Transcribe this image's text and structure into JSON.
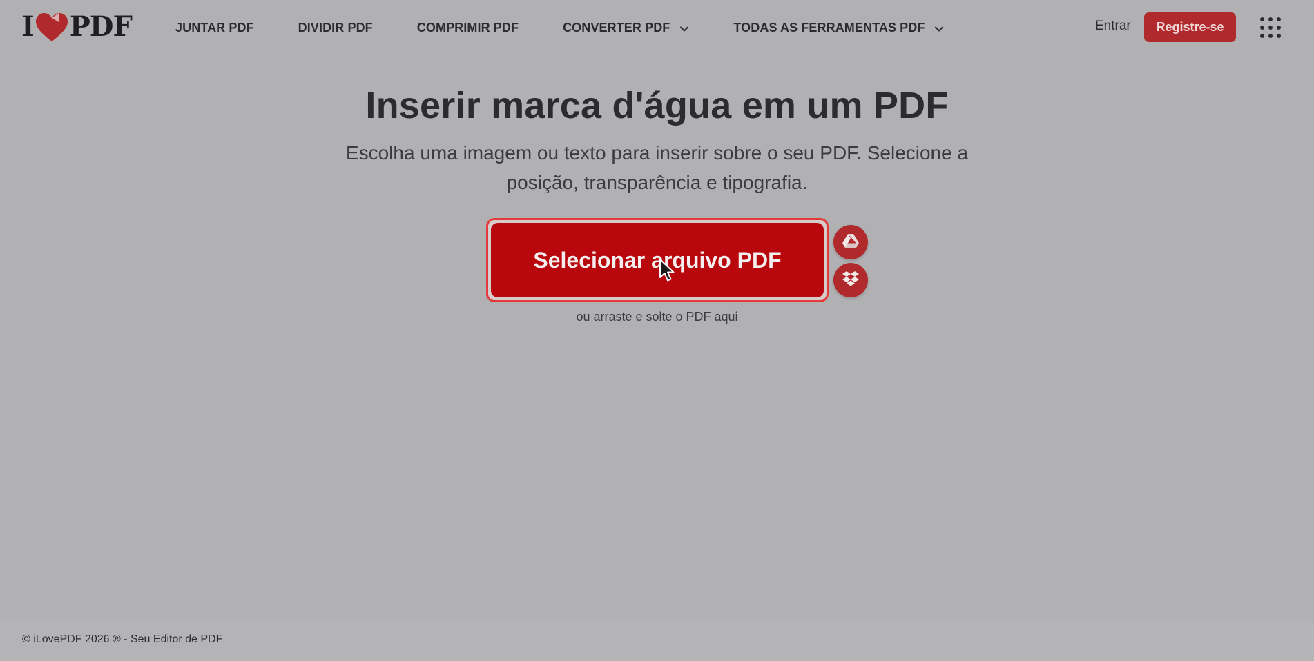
{
  "brand": {
    "logo_left": "I",
    "logo_right": "PDF",
    "accent_color": "#b9080d"
  },
  "nav": {
    "items": [
      {
        "label": "JUNTAR PDF",
        "has_dropdown": false
      },
      {
        "label": "DIVIDIR PDF",
        "has_dropdown": false
      },
      {
        "label": "COMPRIMIR PDF",
        "has_dropdown": false
      },
      {
        "label": "CONVERTER PDF",
        "has_dropdown": true
      },
      {
        "label": "TODAS AS FERRAMENTAS PDF",
        "has_dropdown": true
      }
    ],
    "login_label": "Entrar",
    "signup_label": "Registre-se",
    "apps_icon": "apps-grid-icon"
  },
  "main": {
    "title": "Inserir marca d'água em um PDF",
    "subtitle": "Escolha uma imagem ou texto para inserir sobre o seu PDF. Selecione a posição, transparência e tipografia.",
    "upload_button_label": "Selecionar arquivo PDF",
    "cloud_buttons": [
      {
        "icon": "google-drive-icon"
      },
      {
        "icon": "dropbox-icon"
      }
    ],
    "drop_hint": "ou arraste e solte o PDF aqui"
  },
  "footer": {
    "text": "© iLovePDF 2026 ® - Seu Editor de PDF"
  }
}
